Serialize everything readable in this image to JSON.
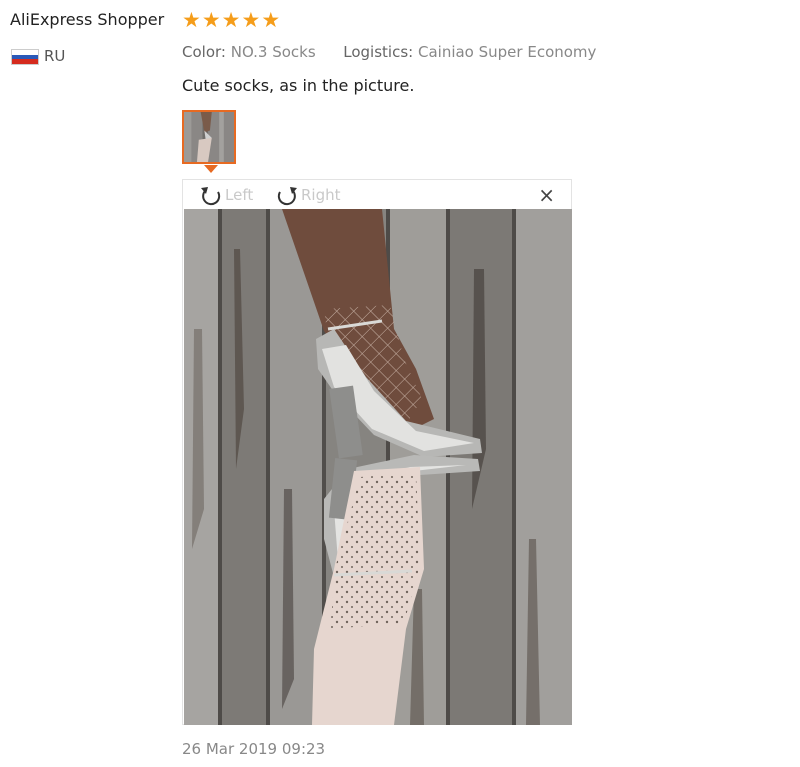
{
  "reviewer": {
    "name": "AliExpress Shopper",
    "country": "RU",
    "flag_colors": [
      "#ffffff",
      "#2a59b8",
      "#d52b1e"
    ]
  },
  "rating": {
    "stars": 5,
    "max": 5,
    "color": "#f59d1a",
    "star_icons": [
      "★",
      "★",
      "★",
      "★",
      "★"
    ]
  },
  "attributes": [
    {
      "label": "Color:",
      "value": "NO.3 Socks"
    },
    {
      "label": "Logistics:",
      "value": "Cainiao Super Economy"
    }
  ],
  "review": {
    "text": "Cute socks, as in the picture."
  },
  "thumbnail": {
    "selected": true,
    "accent_color": "#e76a22"
  },
  "viewer": {
    "rotate_left_label": "Left",
    "rotate_right_label": "Right",
    "close_glyph": "×"
  },
  "review_date": "26 Mar 2019 09:23"
}
